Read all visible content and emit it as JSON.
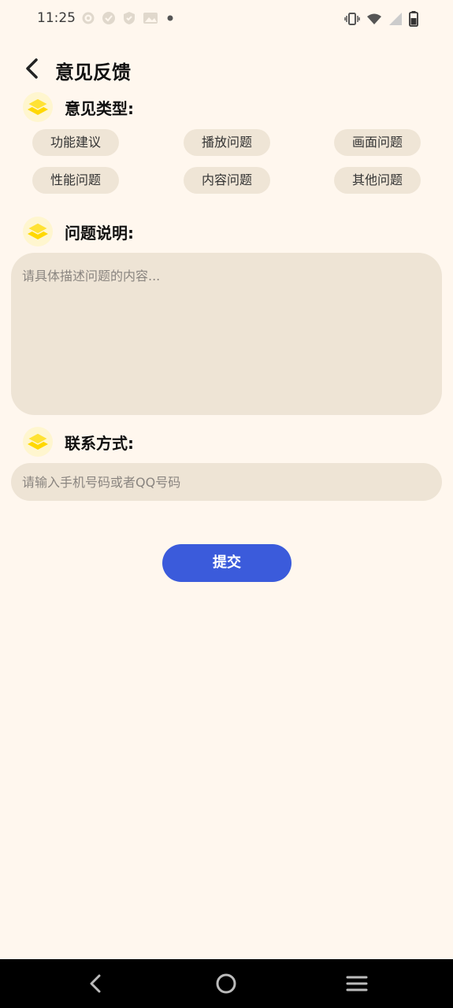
{
  "status_bar": {
    "time": "11:25",
    "left_icons": [
      "settings-icon",
      "vpn-icon",
      "shield-icon",
      "image-icon",
      "dot-icon"
    ],
    "right_icons": [
      "vibrate-icon",
      "wifi-icon",
      "signal-icon",
      "battery-icon"
    ]
  },
  "header": {
    "title": "意见反馈",
    "back_icon": "chevron-left-icon"
  },
  "type_section": {
    "label": "意见类型:",
    "options": [
      "功能建议",
      "播放问题",
      "画面问题",
      "性能问题",
      "内容问题",
      "其他问题"
    ]
  },
  "desc_section": {
    "label": "问题说明:",
    "placeholder": "请具体描述问题的内容..."
  },
  "contact_section": {
    "label": "联系方式:",
    "placeholder": "请输入手机号码或者QQ号码"
  },
  "submit_label": "提交",
  "colors": {
    "background": "#FFF7EE",
    "chip": "#EFE5D6",
    "field": "#EEE4D5",
    "accent": "#3B5BDB",
    "section_icon": "#FFE234"
  },
  "nav_bar": {
    "buttons": [
      "back-nav-icon",
      "home-nav-icon",
      "menu-nav-icon"
    ]
  }
}
